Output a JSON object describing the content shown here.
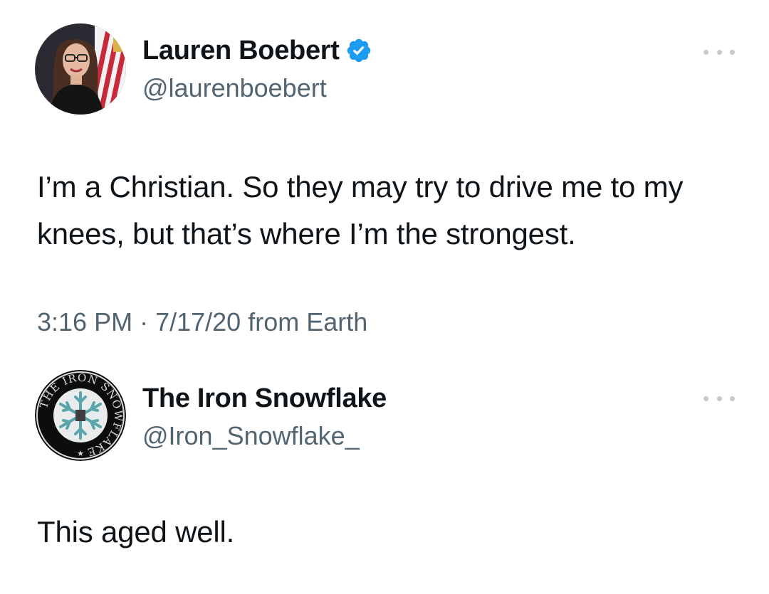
{
  "tweets": [
    {
      "display_name": "Lauren Boebert",
      "verified": true,
      "handle": "@laurenboebert",
      "text": "I’m a Christian. So they may try to drive me to my knees, but that’s where I’m the strongest.",
      "time": "3:16 PM",
      "separator": " · ",
      "date": "7/17/20",
      "source": " from Earth",
      "avatar_icon": "portrait-photo-icon"
    },
    {
      "display_name": "The Iron Snowflake",
      "verified": false,
      "handle": "@Iron_Snowflake_",
      "text": "This aged well.",
      "avatar_icon": "iron-snowflake-logo-icon",
      "avatar_logo_text": "THE IRON SNOWFLAKE"
    }
  ],
  "colors": {
    "text_primary": "#0f1419",
    "text_secondary": "#536471",
    "verified_blue": "#1d9bf0",
    "more_dots": "#c4cacf",
    "logo_teal": "#5aa5ab"
  }
}
